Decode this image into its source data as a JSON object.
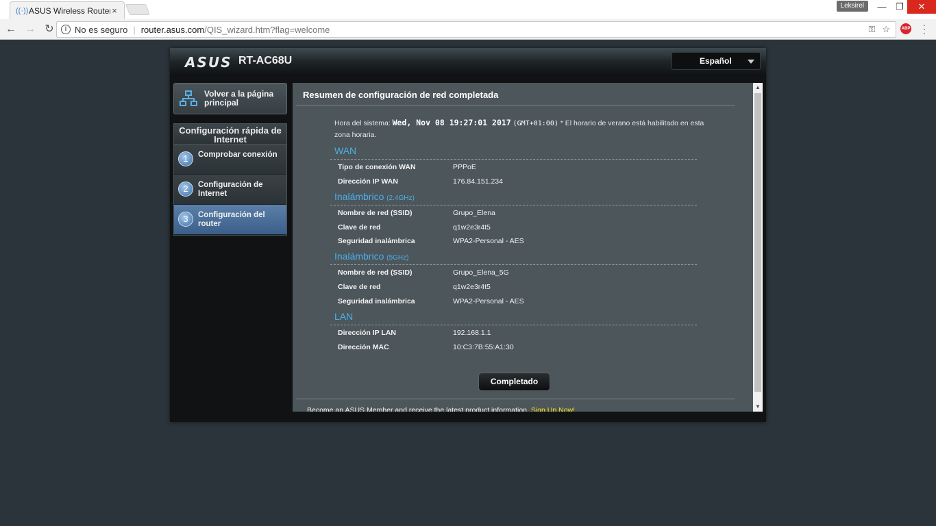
{
  "browser": {
    "tab_title": "ASUS Wireless Router RT",
    "tab_close": "×",
    "user_badge": "Leksirel",
    "security_label": "No es seguro",
    "url_host": "router.asus.com",
    "url_path": "/QIS_wizard.htm?flag=welcome"
  },
  "header": {
    "logo": "ASUS",
    "model": "RT-AC68U",
    "language": "Español"
  },
  "sidebar": {
    "home_label": "Volver a la página principal",
    "qis_title": "Configuración rápida de Internet",
    "steps": [
      {
        "num": "1",
        "label": "Comprobar conexión"
      },
      {
        "num": "2",
        "label": "Configuración de Internet"
      },
      {
        "num": "3",
        "label": "Configuración del router"
      }
    ]
  },
  "main": {
    "title": "Resumen de configuración de red completada",
    "time_prefix": "Hora del sistema:",
    "time_value": "Wed, Nov 08 19:27:01 2017",
    "time_tz": "(GMT+01:00)",
    "time_note": "* El horario de verano está habilitado en esta zona horaria.",
    "wan": {
      "heading": "WAN",
      "rows": [
        {
          "label": "Tipo de conexión WAN",
          "value": "PPPoE"
        },
        {
          "label": "Dirección IP WAN",
          "value": "176.84.151.234"
        }
      ]
    },
    "wireless_24": {
      "heading": "Inalámbrico",
      "band": "(2.4GHz)",
      "rows": [
        {
          "label": "Nombre de red (SSID)",
          "value": "Grupo_Elena"
        },
        {
          "label": "Clave de red",
          "value": "q1w2e3r4t5"
        },
        {
          "label": "Seguridad inalámbrica",
          "value": "WPA2-Personal - AES"
        }
      ]
    },
    "wireless_5": {
      "heading": "Inalámbrico",
      "band": "(5GHz)",
      "rows": [
        {
          "label": "Nombre de red (SSID)",
          "value": "Grupo_Elena_5G"
        },
        {
          "label": "Clave de red",
          "value": "q1w2e3r4t5"
        },
        {
          "label": "Seguridad inalámbrica",
          "value": "WPA2-Personal - AES"
        }
      ]
    },
    "lan": {
      "heading": "LAN",
      "rows": [
        {
          "label": "Dirección IP LAN",
          "value": "192.168.1.1"
        },
        {
          "label": "Dirección MAC",
          "value": "10:C3:7B:55:A1:30"
        }
      ]
    },
    "done_button": "Completado",
    "footer_text": "Become an ASUS Member and receive the latest product information.",
    "footer_link": "Sign Up Now!"
  },
  "colors": {
    "page_bg": "#2b343a",
    "content_bg": "#4d565b",
    "section_heading": "#4ab0e8",
    "active_step": "#4c70a0",
    "footer_link": "#f2e41c"
  }
}
